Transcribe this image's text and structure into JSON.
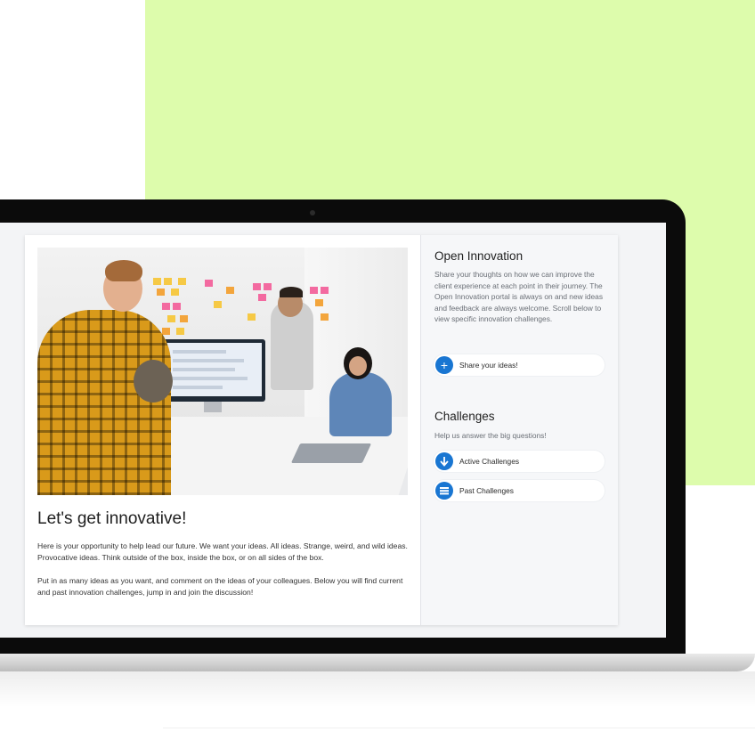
{
  "colors": {
    "background_block": "#ddfcac",
    "accent": "#1976d2",
    "panel": "#f6f7f9"
  },
  "hero_image": {
    "alt": "Team collaborating around a monitor with sticky notes on the wall"
  },
  "main": {
    "headline": "Let's get innovative!",
    "paragraph_1": "Here is your opportunity to help lead our future. We want your ideas. All ideas. Strange, weird, and wild ideas. Provocative ideas. Think outside of the box, inside the box, or on all sides of the box.",
    "paragraph_2": "Put in as many ideas as you want, and comment on the ideas of your colleagues. Below you will find current and past innovation challenges, jump in and join the discussion!"
  },
  "open_innovation": {
    "title": "Open Innovation",
    "description": "Share your thoughts on how we can improve the client experience at each point in their journey. The Open Innovation portal is always on and new ideas and feedback are always welcome. Scroll below to view specific innovation challenges.",
    "share_button": {
      "label": "Share your ideas!",
      "icon": "plus-icon"
    }
  },
  "challenges": {
    "title": "Challenges",
    "subtitle": "Help us answer the big questions!",
    "active_button": {
      "label": "Active Challenges",
      "icon": "arrow-down-icon"
    },
    "past_button": {
      "label": "Past Challenges",
      "icon": "list-icon"
    }
  }
}
